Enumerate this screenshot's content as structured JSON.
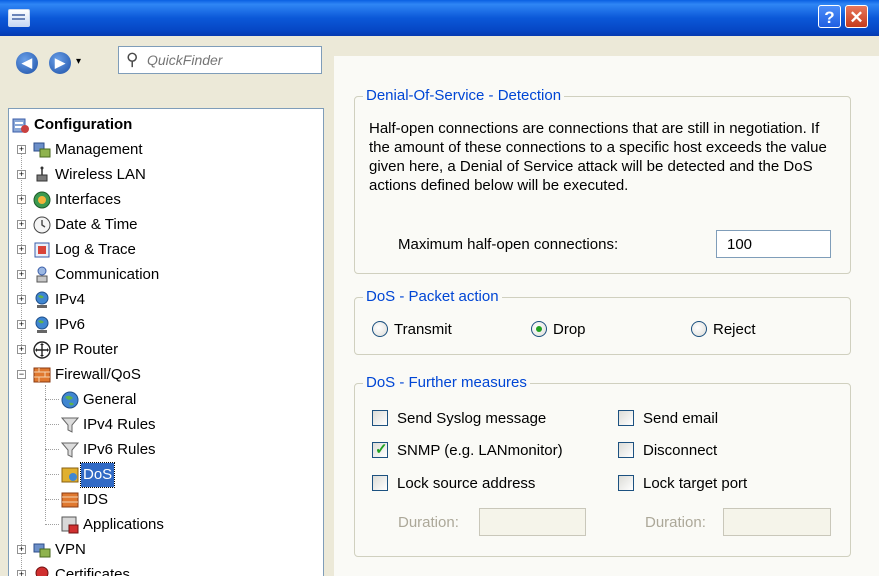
{
  "titlebar": {
    "help_label": "?",
    "close_label": "✕"
  },
  "nav": {
    "back_glyph": "◀",
    "forward_glyph": "▶",
    "dropdown_glyph": "▾",
    "search_placeholder": "QuickFinder"
  },
  "tree": {
    "root_label": "Configuration",
    "items": [
      {
        "label": "Management",
        "icon": "management-icon"
      },
      {
        "label": "Wireless LAN",
        "icon": "wireless-icon"
      },
      {
        "label": "Interfaces",
        "icon": "interfaces-icon"
      },
      {
        "label": "Date & Time",
        "icon": "clock-icon"
      },
      {
        "label": "Log & Trace",
        "icon": "log-icon"
      },
      {
        "label": "Communication",
        "icon": "communication-icon"
      },
      {
        "label": "IPv4",
        "icon": "ipv4-icon"
      },
      {
        "label": "IPv6",
        "icon": "ipv6-icon"
      },
      {
        "label": "IP Router",
        "icon": "router-icon"
      },
      {
        "label": "Firewall/QoS",
        "icon": "firewall-icon"
      },
      {
        "label": "VPN",
        "icon": "vpn-icon"
      },
      {
        "label": "Certificates",
        "icon": "certificate-icon"
      }
    ],
    "firewall_children": [
      {
        "label": "General",
        "icon": "globe-icon"
      },
      {
        "label": "IPv4 Rules",
        "icon": "filter-icon"
      },
      {
        "label": "IPv6 Rules",
        "icon": "filter-icon"
      },
      {
        "label": "DoS",
        "icon": "dos-icon",
        "selected": true
      },
      {
        "label": "IDS",
        "icon": "ids-icon"
      },
      {
        "label": "Applications",
        "icon": "applications-icon"
      }
    ]
  },
  "dos_detection": {
    "title": "Denial-Of-Service - Detection",
    "description": "Half-open connections are connections that are still in negotiation. If the amount of these connections to a specific host exceeds the value given here, a Denial of Service attack will be detected and the DoS actions defined below will be executed.",
    "max_label": "Maximum half-open connections:",
    "max_value": "100"
  },
  "packet_action": {
    "title": "DoS - Packet action",
    "options": [
      "Transmit",
      "Drop",
      "Reject"
    ],
    "selected": "Drop"
  },
  "further_measures": {
    "title": "DoS - Further measures",
    "send_syslog": {
      "label": "Send Syslog message",
      "checked": false
    },
    "send_email": {
      "label": "Send email",
      "checked": false
    },
    "snmp": {
      "label": "SNMP (e.g. LANmonitor)",
      "checked": true
    },
    "disconnect": {
      "label": "Disconnect",
      "checked": false
    },
    "lock_source": {
      "label": "Lock source address",
      "checked": false
    },
    "lock_target": {
      "label": "Lock target port",
      "checked": false
    },
    "duration_label": "Duration:",
    "duration_source_value": "",
    "duration_target_value": ""
  },
  "colors": {
    "titlebar": "#0a5fe2",
    "group_title": "#0046d5",
    "selection": "#316ac5",
    "check_green": "#21a121"
  }
}
